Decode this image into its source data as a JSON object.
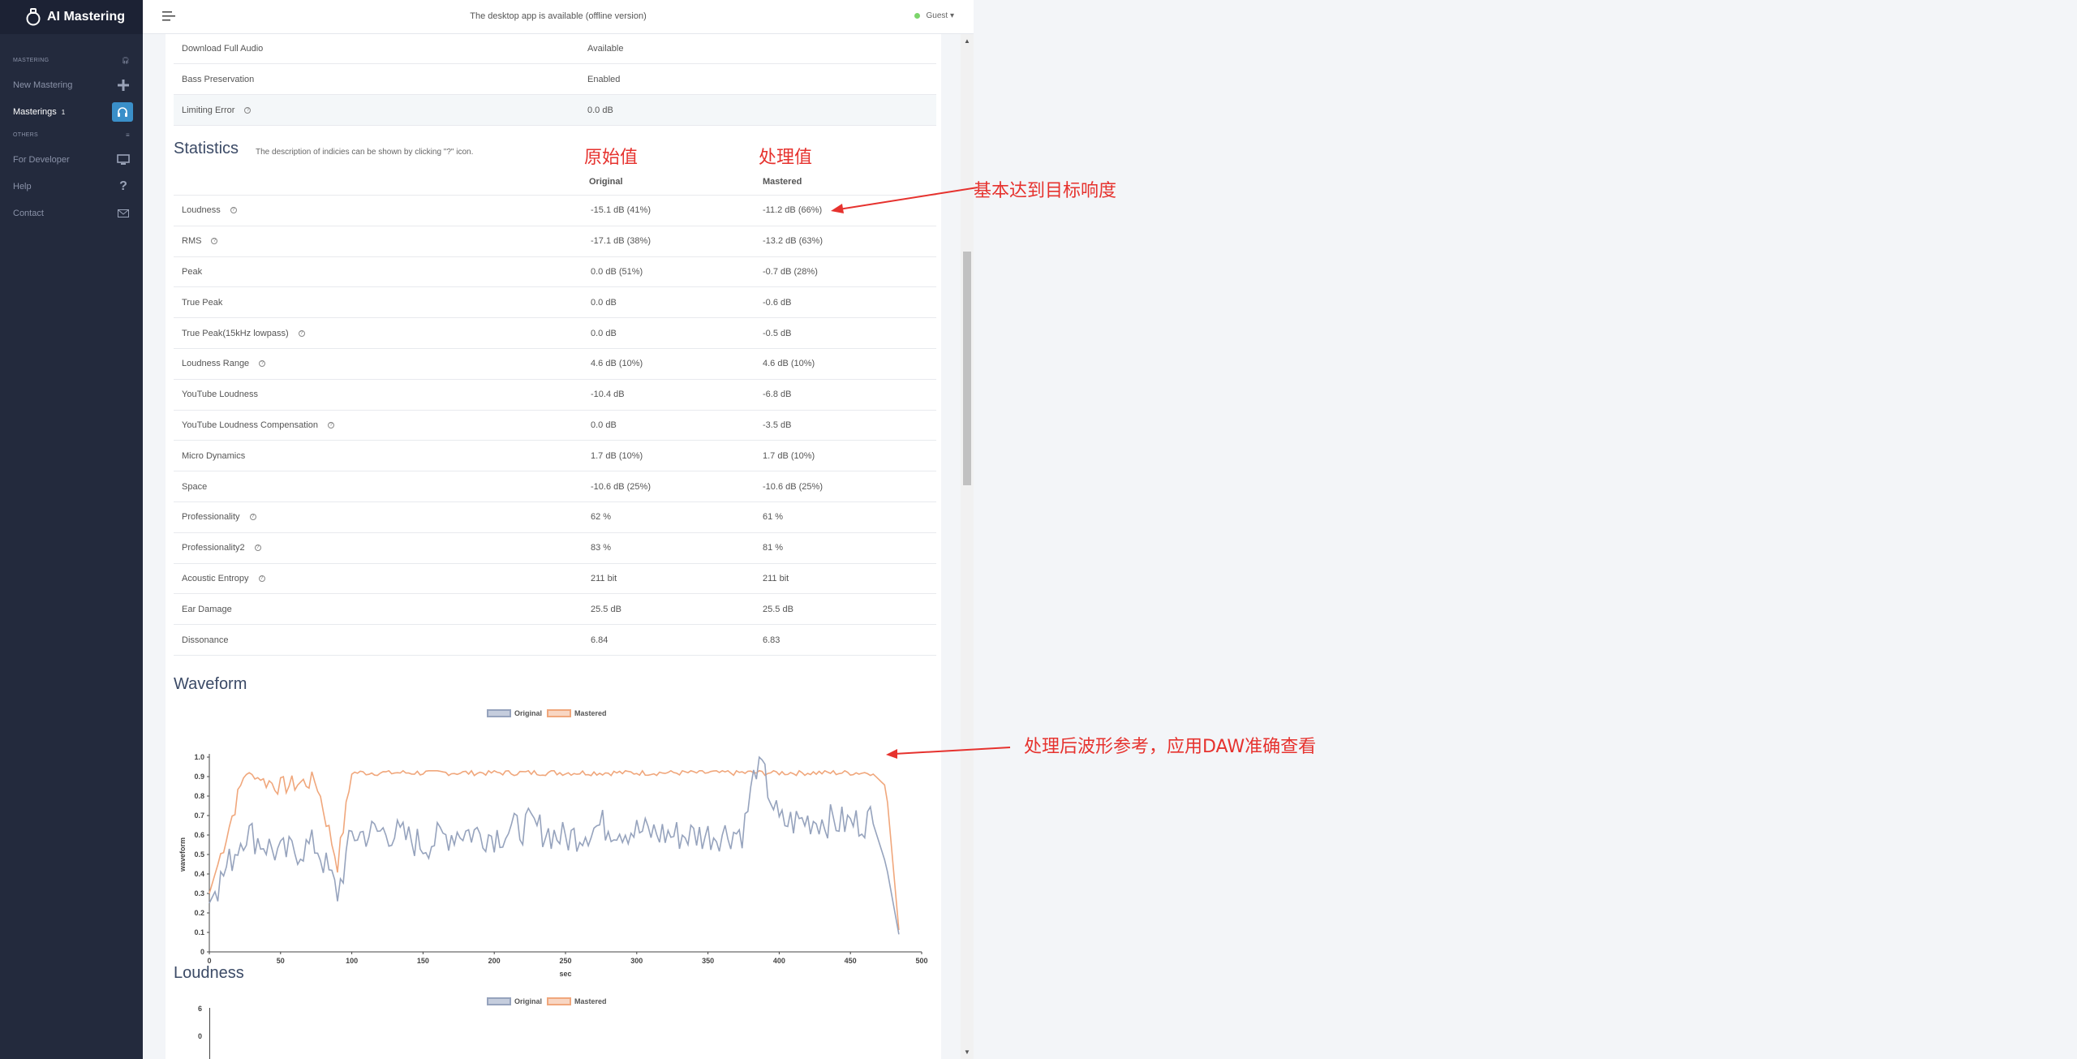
{
  "app": {
    "brand": "AI Mastering"
  },
  "topbar": {
    "message": "The desktop app is available (offline version)",
    "user": "Guest ▾"
  },
  "sidebar": {
    "section_mastering": "MASTERING",
    "section_others": "OTHERS",
    "items": [
      {
        "label": "New Mastering",
        "icon": "plus-icon"
      },
      {
        "label": "Masterings",
        "count": "1",
        "icon": "headphones-icon"
      },
      {
        "label": "For Developer",
        "icon": "monitor-icon"
      },
      {
        "label": "Help",
        "icon": "question-icon"
      },
      {
        "label": "Contact",
        "icon": "mail-icon"
      }
    ]
  },
  "settings": [
    {
      "name": "Download Full Audio",
      "value": "Available"
    },
    {
      "name": "Bass Preservation",
      "value": "Enabled"
    },
    {
      "name": "Limiting Error",
      "value": "0.0 dB"
    }
  ],
  "statistics": {
    "title": "Statistics",
    "description": "The description of indicies can be shown by clicking \"?\" icon.",
    "col_original": "Original",
    "col_mastered": "Mastered",
    "rows": [
      {
        "name": "Loudness",
        "original": "-15.1 dB (41%)",
        "mastered": "-11.2 dB (66%)",
        "help": true
      },
      {
        "name": "RMS",
        "original": "-17.1 dB (38%)",
        "mastered": "-13.2 dB (63%)",
        "help": true
      },
      {
        "name": "Peak",
        "original": "0.0 dB (51%)",
        "mastered": "-0.7 dB (28%)",
        "help": false
      },
      {
        "name": "True Peak",
        "original": "0.0 dB",
        "mastered": "-0.6 dB",
        "help": false
      },
      {
        "name": "True Peak(15kHz lowpass)",
        "original": "0.0 dB",
        "mastered": "-0.5 dB",
        "help": true
      },
      {
        "name": "Loudness Range",
        "original": "4.6 dB (10%)",
        "mastered": "4.6 dB (10%)",
        "help": true
      },
      {
        "name": "YouTube Loudness",
        "original": "-10.4 dB",
        "mastered": "-6.8 dB",
        "help": false
      },
      {
        "name": "YouTube Loudness Compensation",
        "original": "0.0 dB",
        "mastered": "-3.5 dB",
        "help": true
      },
      {
        "name": "Micro Dynamics",
        "original": "1.7 dB (10%)",
        "mastered": "1.7 dB (10%)",
        "help": false
      },
      {
        "name": "Space",
        "original": "-10.6 dB (25%)",
        "mastered": "-10.6 dB (25%)",
        "help": false
      },
      {
        "name": "Professionality",
        "original": "62 %",
        "mastered": "61 %",
        "help": true
      },
      {
        "name": "Professionality2",
        "original": "83 %",
        "mastered": "81 %",
        "help": true
      },
      {
        "name": "Acoustic Entropy",
        "original": "211 bit",
        "mastered": "211 bit",
        "help": true
      },
      {
        "name": "Ear Damage",
        "original": "25.5 dB",
        "mastered": "25.5 dB",
        "help": false
      },
      {
        "name": "Dissonance",
        "original": "6.84",
        "mastered": "6.83",
        "help": false
      }
    ]
  },
  "annotations": {
    "original_label": "原始值",
    "mastered_label": "处理值",
    "loudness_note": "基本达到目标响度",
    "waveform_note": "处理后波形参考，应用DAW准确查看"
  },
  "colors": {
    "original": "#96a3bd",
    "mastered": "#f0a77c",
    "annotation": "#e6322e",
    "sidebar": "#232a3d",
    "accent": "#3a8fc9"
  },
  "waveform": {
    "title": "Waveform",
    "legend_original": "Original",
    "legend_mastered": "Mastered",
    "xlabel": "sec",
    "ylabel": "waveform",
    "chart_data": {
      "type": "line",
      "x": [
        0,
        25,
        50,
        75,
        90,
        100,
        125,
        150,
        175,
        200,
        225,
        250,
        275,
        300,
        325,
        350,
        375,
        385,
        400,
        425,
        450,
        465,
        475,
        485
      ],
      "series": [
        {
          "name": "Original",
          "values": [
            0.25,
            0.62,
            0.5,
            0.55,
            0.3,
            0.6,
            0.62,
            0.55,
            0.62,
            0.6,
            0.65,
            0.58,
            0.65,
            0.62,
            0.6,
            0.6,
            0.62,
            1.0,
            0.66,
            0.68,
            0.66,
            0.68,
            0.45,
            0.05
          ]
        },
        {
          "name": "Mastered",
          "values": [
            0.3,
            0.92,
            0.85,
            0.88,
            0.45,
            0.92,
            0.92,
            0.92,
            0.92,
            0.92,
            0.92,
            0.92,
            0.92,
            0.92,
            0.92,
            0.92,
            0.92,
            0.92,
            0.92,
            0.92,
            0.92,
            0.92,
            0.85,
            0.03
          ]
        }
      ],
      "xlim": [
        0,
        500
      ],
      "ylim": [
        0,
        1.0
      ],
      "xticks": [
        "0",
        "50",
        "100",
        "150",
        "200",
        "250",
        "300",
        "350",
        "400",
        "450",
        "500"
      ],
      "yticks": [
        "0",
        "0.1",
        "0.2",
        "0.3",
        "0.4",
        "0.5",
        "0.6",
        "0.7",
        "0.8",
        "0.9",
        "1.0"
      ]
    }
  },
  "loudness_chart": {
    "title": "Loudness",
    "legend_original": "Original",
    "legend_mastered": "Mastered",
    "yticks": [
      "6",
      "0"
    ]
  }
}
